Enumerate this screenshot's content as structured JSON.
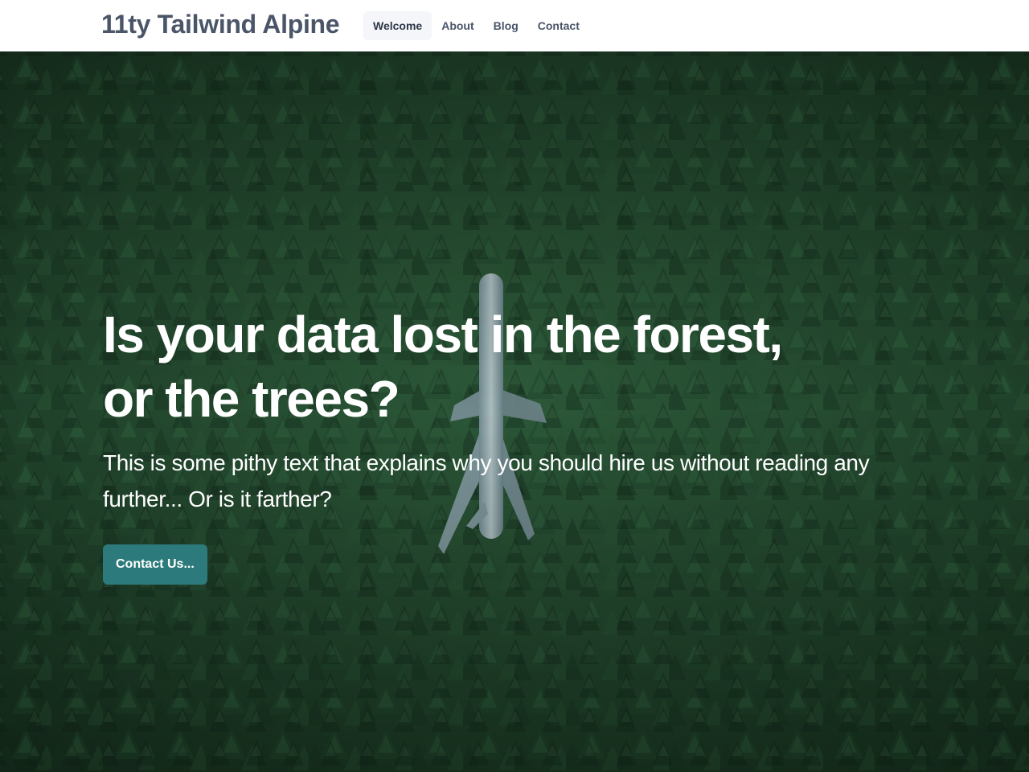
{
  "header": {
    "brand": "11ty Tailwind Alpine",
    "nav": [
      {
        "label": "Welcome",
        "active": true
      },
      {
        "label": "About",
        "active": false
      },
      {
        "label": "Blog",
        "active": false
      },
      {
        "label": "Contact",
        "active": false
      }
    ]
  },
  "hero": {
    "title_line1": "Is your data lost in the forest,",
    "title_line2": "or the trees?",
    "subtitle": "This is some pithy text that explains why you should hire us without reading any further... Or is it farther?",
    "cta_label": "Contact Us..."
  },
  "colors": {
    "header_bg": "#ffffff",
    "brand_text": "#4a5568",
    "nav_active_bg": "#f4f6f9",
    "cta_bg": "#2c7a7b",
    "forest_dark": "#15301f",
    "forest_mid": "#2b5a38"
  }
}
